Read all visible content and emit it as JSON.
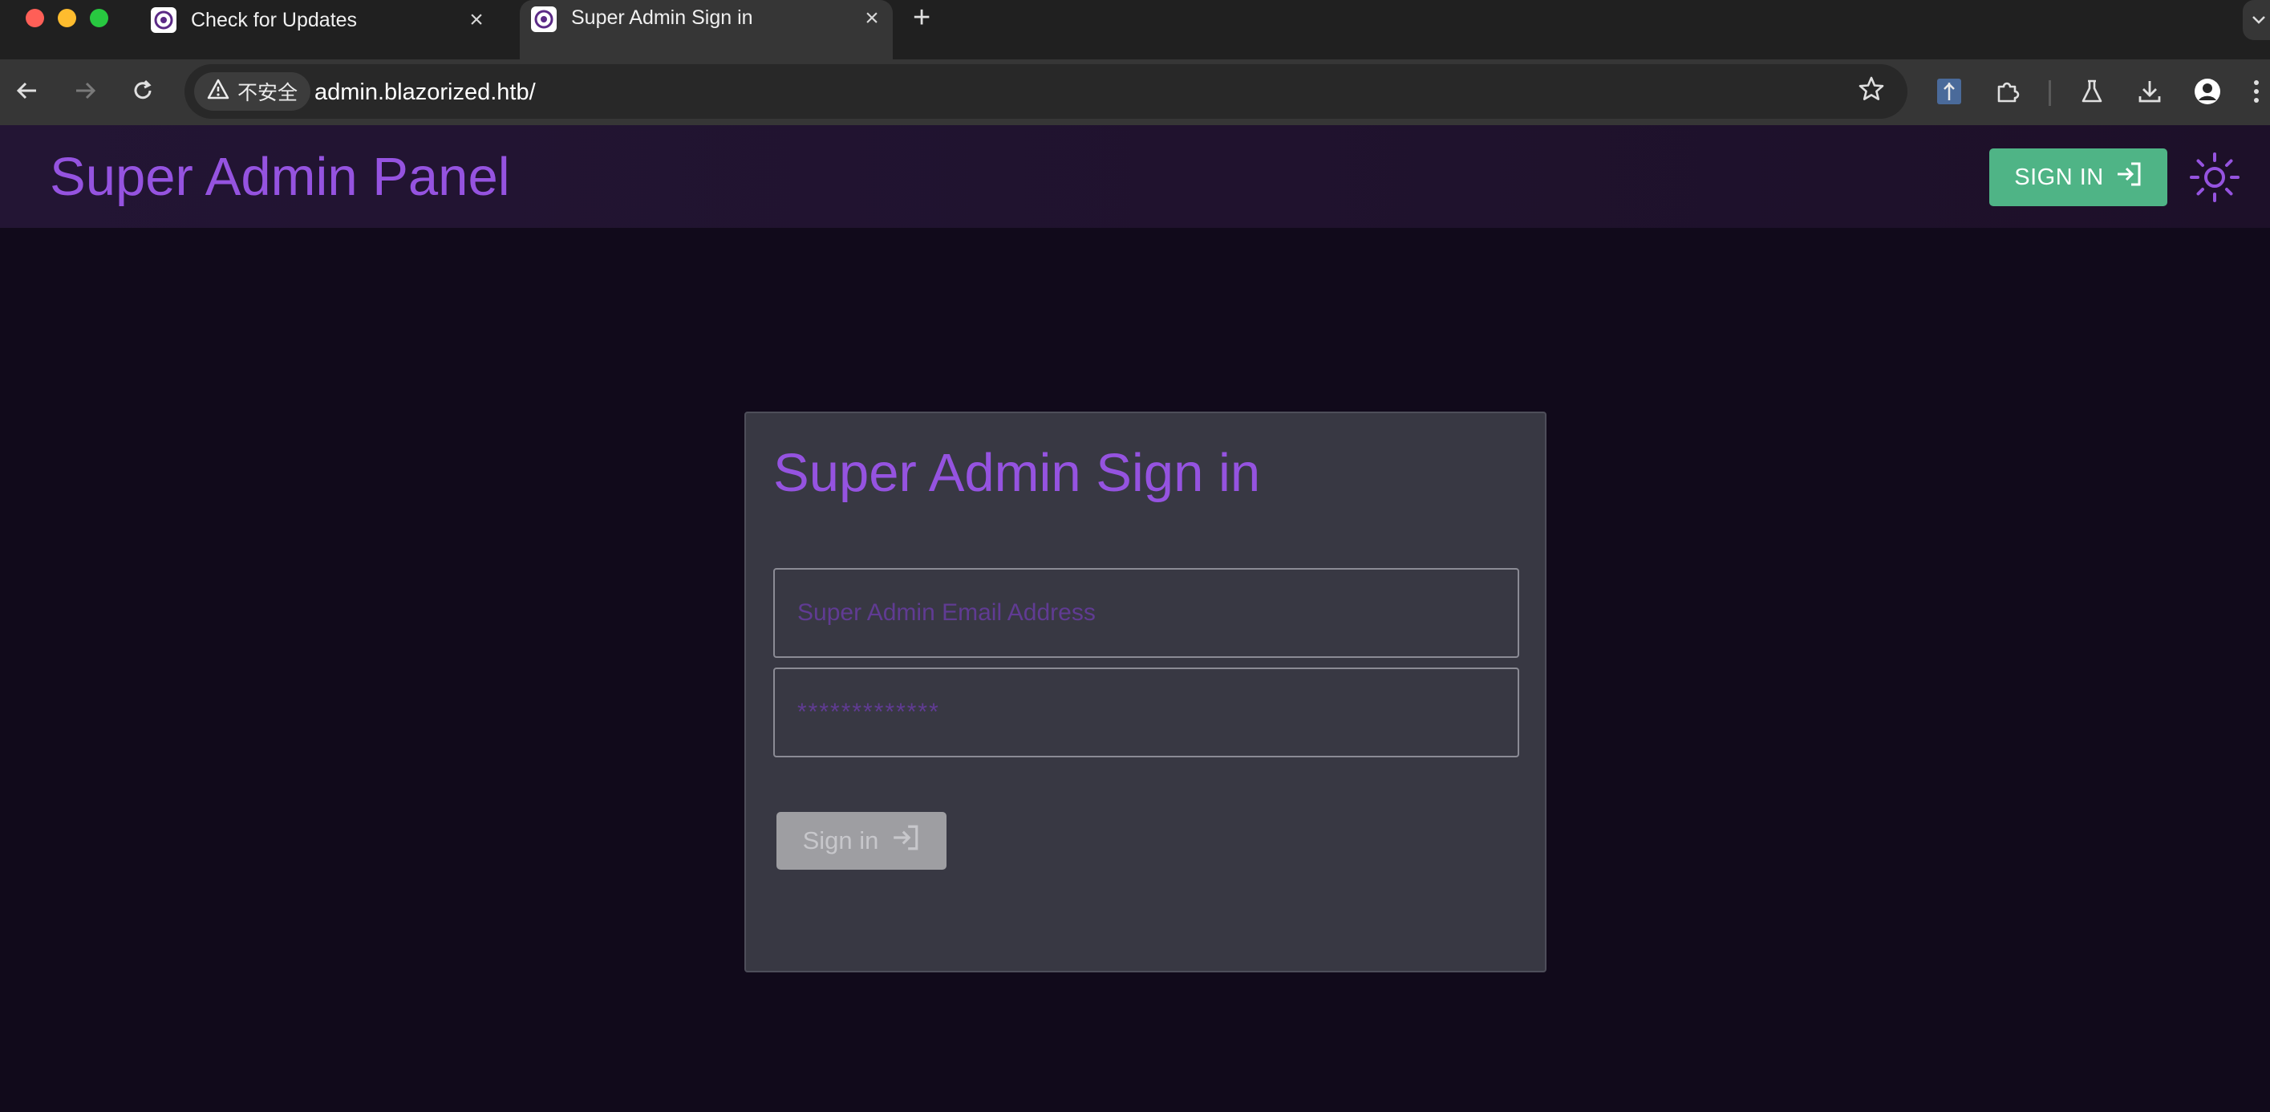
{
  "browser": {
    "tabs": [
      {
        "title": "Check for Updates",
        "active": false
      },
      {
        "title": "Super Admin Sign in",
        "active": true
      }
    ],
    "new_tab_symbol": "+",
    "close_symbol": "×",
    "security_label": "不安全",
    "url": "admin.blazorized.htb/",
    "icons": [
      "back-arrow-icon",
      "forward-arrow-icon",
      "reload-icon",
      "warning-icon",
      "star-icon",
      "extension-icon",
      "puzzle-icon",
      "labs-flask-icon",
      "download-icon",
      "profile-icon",
      "kebab-menu-icon"
    ]
  },
  "header": {
    "title": "Super Admin Panel",
    "signin_label": "SIGN IN",
    "signin_color": "#4fb486",
    "theme_toggle_icon": "sun-icon"
  },
  "card": {
    "title": "Super Admin Sign in",
    "email_placeholder": "Super Admin Email Address",
    "password_placeholder": "*************",
    "signin_label": "Sign in",
    "signin_icon": "login-arrow-icon"
  },
  "colors": {
    "accent": "#9553e0",
    "page_bg": "#110a1b",
    "card_bg": "#383843"
  }
}
